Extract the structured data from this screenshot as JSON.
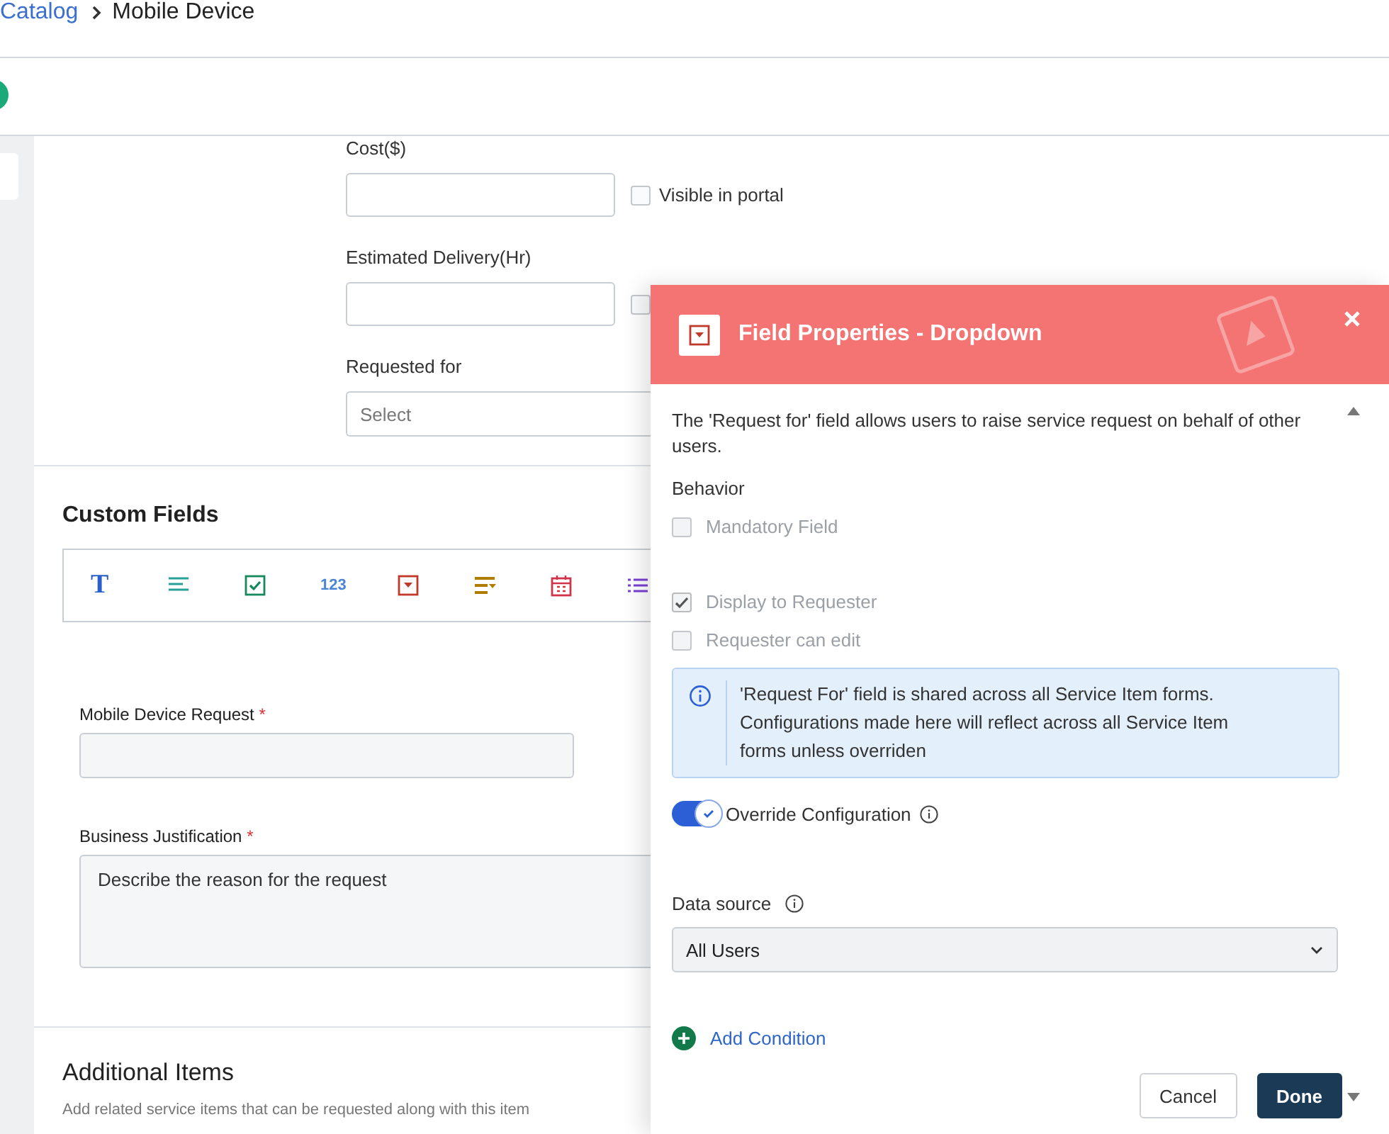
{
  "breadcrumb": {
    "link": "Catalog",
    "current": "Mobile Device"
  },
  "item_fields": [
    {
      "label": "Cost($)",
      "portal": {
        "label": "Visible in portal",
        "checked": false
      }
    },
    {
      "label": "Estimated Delivery(Hr)",
      "portal": {
        "checked": false
      }
    }
  ],
  "requested_for": {
    "label": "Requested for",
    "placeholder": "Select"
  },
  "custom_fields": {
    "title": "Custom Fields",
    "toolbar": [
      {
        "kind": "text",
        "label": "T"
      },
      {
        "kind": "paragraph"
      },
      {
        "kind": "checkbox"
      },
      {
        "kind": "number",
        "label": "123"
      },
      {
        "kind": "dropdown"
      },
      {
        "kind": "multiselect"
      },
      {
        "kind": "date"
      },
      {
        "kind": "list"
      }
    ],
    "fields": [
      {
        "kind": "input",
        "label": "Mobile Device Request",
        "required_mark": "*"
      },
      {
        "kind": "textarea",
        "label": "Business Justification",
        "required_mark": "*",
        "value": "Describe the reason for the request"
      }
    ]
  },
  "additional_items": {
    "title": "Additional Items",
    "description": "Add related service items that can be requested along with this item"
  },
  "panel": {
    "title": "Field Properties - Dropdown",
    "description": "The 'Request for' field allows users to raise service request on behalf of other users.",
    "behavior_label": "Behavior",
    "options": [
      {
        "label": "Mandatory Field",
        "checked": false,
        "disabled": true
      },
      {
        "label": "Display to Requester",
        "checked": true,
        "disabled": true
      },
      {
        "label": "Requester can edit",
        "checked": false,
        "disabled": true
      }
    ],
    "info": "'Request For' field is shared across all Service Item forms. Configurations made here will reflect across all Service Item forms unless overriden",
    "override": {
      "label": "Override Configuration",
      "on": true
    },
    "data_source": {
      "label": "Data source",
      "value": "All Users"
    },
    "add_condition": "Add Condition",
    "buttons": [
      {
        "kind": "secondary",
        "label": "Cancel"
      },
      {
        "kind": "primary",
        "label": "Done"
      }
    ]
  }
}
